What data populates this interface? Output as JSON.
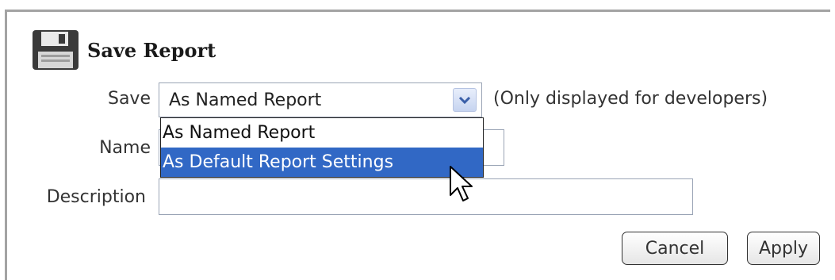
{
  "dialog": {
    "title": "Save Report"
  },
  "form": {
    "save_label": "Save",
    "save_value": "As Named Report",
    "save_hint": "(Only displayed for developers)",
    "name_label": "Name",
    "name_value": "",
    "description_label": "Description",
    "description_value": ""
  },
  "dropdown": {
    "options": [
      {
        "label": "As Named Report",
        "selected": false
      },
      {
        "label": "As Default Report Settings",
        "selected": true
      }
    ]
  },
  "buttons": {
    "cancel": "Cancel",
    "apply": "Apply"
  },
  "colors": {
    "highlight": "#3168c5",
    "panel_border": "#a3a3a3",
    "input_border": "#9aa4b5"
  },
  "icons": {
    "title_icon": "floppy-disk-icon",
    "select_arrow": "chevron-down-icon",
    "pointer": "mouse-cursor-icon"
  }
}
